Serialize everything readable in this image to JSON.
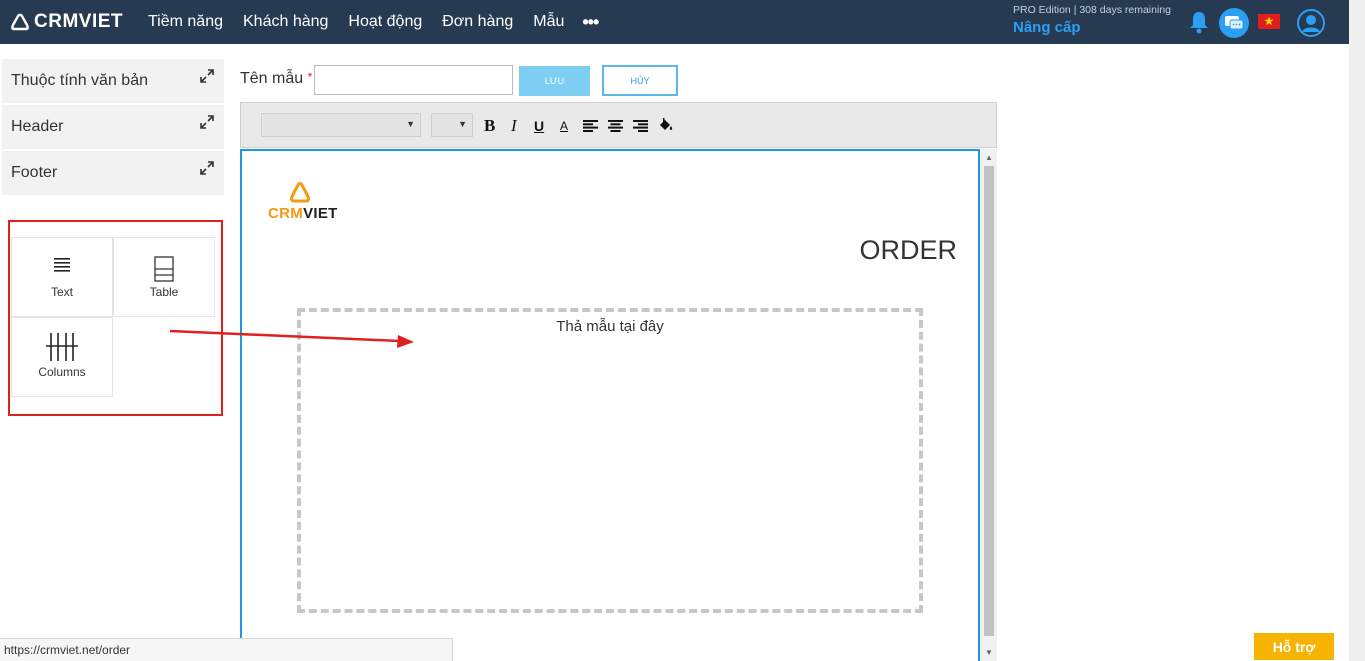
{
  "brand": {
    "name": "CRMVIET"
  },
  "nav": {
    "items": [
      {
        "label": "Tiềm năng"
      },
      {
        "label": "Khách hàng"
      },
      {
        "label": "Hoạt động"
      },
      {
        "label": "Đơn hàng"
      },
      {
        "label": "Mẫu"
      }
    ],
    "more_label": "•••"
  },
  "account": {
    "edition": "PRO Edition | 308 days remaining",
    "upgrade_label": "Nâng cấp"
  },
  "left_panel": {
    "items": [
      {
        "label": "Thuộc tính văn bản"
      },
      {
        "label": "Header"
      },
      {
        "label": "Footer"
      }
    ],
    "widgets": [
      {
        "label": "Text",
        "icon": "text-lines-icon"
      },
      {
        "label": "Table",
        "icon": "table-icon"
      },
      {
        "label": "Columns",
        "icon": "columns-icon"
      }
    ]
  },
  "form": {
    "name_label": "Tên mẫu",
    "required_mark": "*",
    "name_value": "",
    "save_label": "LƯU",
    "cancel_label": "HỦY"
  },
  "toolbar": {
    "bold": "B",
    "italic": "I",
    "underline": "U",
    "font_color": "A"
  },
  "document": {
    "logo_text_a": "CRM",
    "logo_text_b": "VIET",
    "title": "ORDER",
    "drop_placeholder": "Thả mẫu tại đây"
  },
  "status_bar": {
    "url": "https://crmviet.net/order"
  },
  "help": {
    "label": "Hỗ trợ"
  },
  "colors": {
    "topbar": "#263a52",
    "accent_blue": "#1e9be0",
    "highlight_red": "#e0201e",
    "help_orange": "#f6b300",
    "logo_orange": "#f39c12"
  }
}
